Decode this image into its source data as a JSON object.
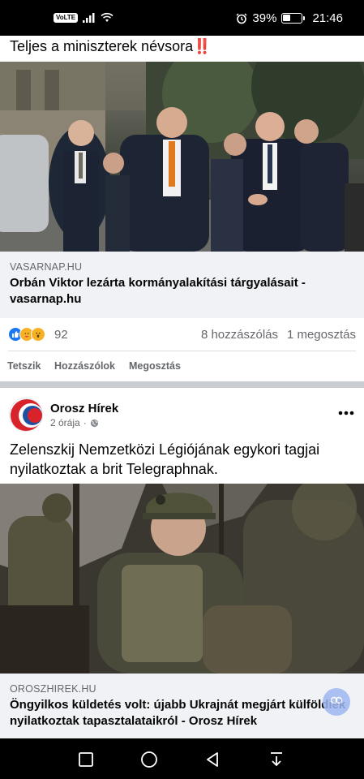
{
  "status_bar": {
    "volte": "VoLTE",
    "battery_percent": "39%",
    "battery_level": 0.39,
    "time": "21:46",
    "icons": [
      "volte-icon",
      "signal-icon",
      "wifi-icon",
      "alarm-icon",
      "battery-icon"
    ]
  },
  "post1": {
    "text": "Teljes a miniszterek névsora",
    "text_emoji": "‼️",
    "link": {
      "domain": "VASARNAP.HU",
      "title": "Orbán Viktor lezárta kormányalakítási tárgyalásait - vasarnap.hu"
    },
    "reaction_count": "92",
    "reaction_icons": [
      "like-icon",
      "care-icon",
      "wow-icon"
    ],
    "comments": "8 hozzászólás",
    "shares": "1 megosztás",
    "actions": {
      "like": "Tetszik",
      "comment": "Hozzászólok",
      "share": "Megosztás"
    }
  },
  "post2": {
    "page_name": "Orosz Hírek",
    "time": "2 órája",
    "meta_separator": "·",
    "text": "Zelenszkij Nemzetközi Légiójának egykori tagjai nyilatkoztak a brit Telegraphnak.",
    "link": {
      "domain": "OROSZHIREK.HU",
      "title": "Öngyilkos küldetés volt: újabb Ukrajnát megjárt külföldiek nyilatkoztak tapasztalataikról - Orosz Hírek"
    }
  },
  "colors": {
    "fb_blue": "#1877f2",
    "text_secondary": "#65676b",
    "link_bg": "#f0f2f5",
    "avatar_red": "#d8232a",
    "avatar_blue": "#1f4fa0"
  }
}
